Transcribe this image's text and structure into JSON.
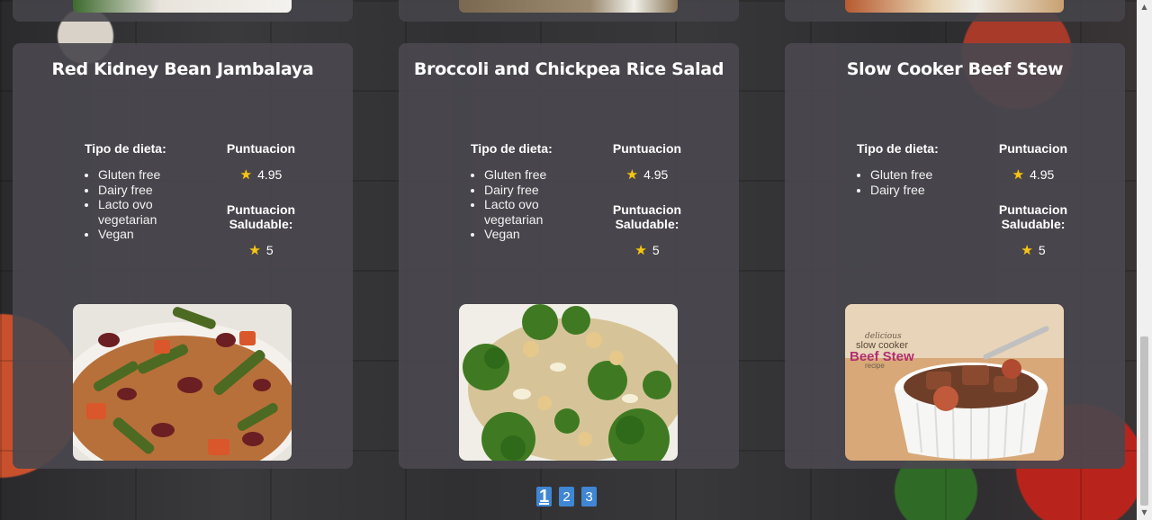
{
  "labels": {
    "diet": "Tipo de dieta:",
    "score": "Puntuacion",
    "health": "Puntuacion Saludable:"
  },
  "recipes": [
    {
      "title": "Red Kidney Bean Jambalaya",
      "diets": [
        "Gluten free",
        "Dairy free",
        "Lacto ovo vegetarian",
        "Vegan"
      ],
      "score": "4.95",
      "health_score": "5",
      "image": "jambalaya-photo"
    },
    {
      "title": "Broccoli and Chickpea Rice Salad",
      "diets": [
        "Gluten free",
        "Dairy free",
        "Lacto ovo vegetarian",
        "Vegan"
      ],
      "score": "4.95",
      "health_score": "5",
      "image": "broccoli-salad-photo"
    },
    {
      "title": "Slow Cooker Beef Stew",
      "diets": [
        "Gluten free",
        "Dairy free"
      ],
      "score": "4.95",
      "health_score": "5",
      "image": "beef-stew-photo",
      "image_text": {
        "line1": "delicious",
        "line2": "slow cooker",
        "line3": "Beef Stew",
        "line4": "recipe"
      }
    }
  ],
  "pagination": {
    "pages": [
      "1",
      "2",
      "3"
    ],
    "current": "1"
  },
  "icons": {
    "star": "star-icon",
    "scroll_up": "chevron-up-icon",
    "scroll_down": "chevron-down-icon"
  },
  "colors": {
    "card_bg": "#4a484e",
    "pager_bg": "#3f86d4",
    "star": "#f5c518"
  }
}
